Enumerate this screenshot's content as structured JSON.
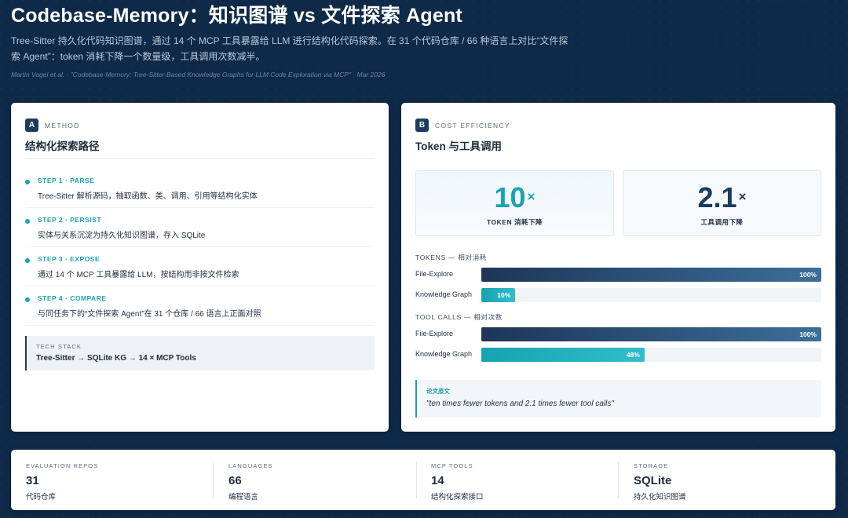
{
  "header": {
    "title": "Codebase-Memory：知识图谱 vs 文件探索 Agent",
    "subtitle": "Tree-Sitter 持久化代码知识图谱，通过 14 个 MCP 工具暴露给 LLM 进行结构化代码探索。在 31 个代码仓库 / 66 种语言上对比“文件探索 Agent”：token 消耗下降一个数量级，工具调用次数减半。",
    "citation": "Martin Vogel et al. · \"Codebase-Memory: Tree-Sitter-Based Knowledge Graphs for LLM Code Exploration via MCP\" · Mar 2026"
  },
  "panel_a": {
    "badge": "A",
    "kicker": "METHOD",
    "title": "结构化探索路径",
    "steps": [
      {
        "label": "STEP 1 · PARSE",
        "desc": "Tree-Sitter 解析源码，抽取函数、类、调用、引用等结构化实体"
      },
      {
        "label": "STEP 2 · PERSIST",
        "desc": "实体与关系沉淀为持久化知识图谱，存入 SQLite"
      },
      {
        "label": "STEP 3 · EXPOSE",
        "desc": "通过 14 个 MCP 工具暴露给 LLM，按结构而非按文件检索"
      },
      {
        "label": "STEP 4 · COMPARE",
        "desc": "与同任务下的“文件探索 Agent”在 31 个仓库 / 66 语言上正面对照"
      }
    ],
    "tech_stack": {
      "label": "TECH STACK",
      "value": "Tree-Sitter → SQLite KG → 14 × MCP Tools"
    }
  },
  "panel_b": {
    "badge": "B",
    "kicker": "COST EFFICIENCY",
    "title": "Token 与工具调用",
    "metrics": [
      {
        "value": "10",
        "suffix": "×",
        "label": "TOKEN 消耗下降"
      },
      {
        "value": "2.1",
        "suffix": "×",
        "label": "工具调用下降"
      }
    ],
    "tokens_label": "TOKENS — 相对消耗",
    "tool_calls_label": "TOOL CALLS — 相对次数",
    "quote_label": "论文原文",
    "quote_text": "\"ten times fewer tokens and 2.1 times fewer tool calls\""
  },
  "chart_data": {
    "type": "bar",
    "orientation": "horizontal",
    "groups": [
      {
        "name": "TOKENS — 相对消耗",
        "bars": [
          {
            "label": "File-Explore",
            "value": 100,
            "display": "100%",
            "color": "#1d3558"
          },
          {
            "label": "Knowledge Graph",
            "value": 10,
            "display": "10%",
            "color": "#16a2b0"
          }
        ]
      },
      {
        "name": "TOOL CALLS — 相对次数",
        "bars": [
          {
            "label": "File-Explore",
            "value": 100,
            "display": "100%",
            "color": "#1d3558"
          },
          {
            "label": "Knowledge Graph",
            "value": 48,
            "display": "48%",
            "color": "#16a2b0"
          }
        ]
      }
    ],
    "xlim": [
      0,
      100
    ]
  },
  "stats": [
    {
      "label": "EVALUATION REPOS",
      "value": "31",
      "desc": "代码仓库"
    },
    {
      "label": "LANGUAGES",
      "value": "66",
      "desc": "编程语言"
    },
    {
      "label": "MCP TOOLS",
      "value": "14",
      "desc": "结构化探索接口"
    },
    {
      "label": "STORAGE",
      "value": "SQLite",
      "desc": "持久化知识图谱"
    }
  ],
  "colors": {
    "background": "#0f2a49",
    "accent_teal": "#1aa3b2",
    "navy": "#1d3b5e"
  }
}
